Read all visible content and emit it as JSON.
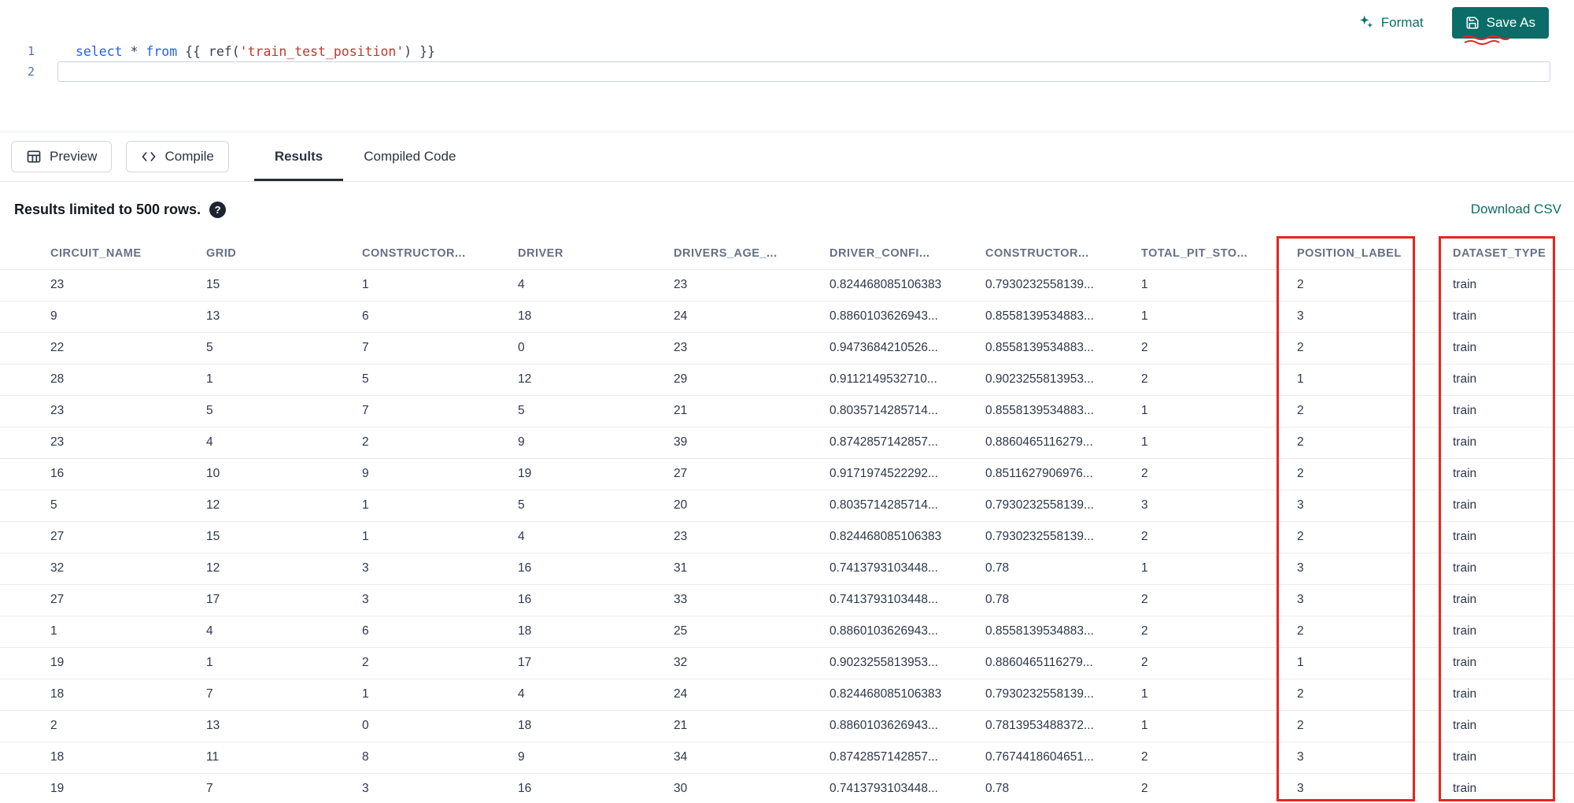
{
  "toolbar": {
    "format_label": "Format",
    "save_as_label": "Save As"
  },
  "editor": {
    "line_numbers": [
      "1",
      "2"
    ],
    "code": {
      "kw_select": "select",
      "star": " * ",
      "kw_from": "from",
      "jinja_open": " {{ ",
      "fn": "ref(",
      "string": "'train_test_position'",
      "jinja_close": ") }}"
    }
  },
  "actions": {
    "preview_label": "Preview",
    "compile_label": "Compile"
  },
  "tabs": {
    "results": "Results",
    "compiled_code": "Compiled Code"
  },
  "results": {
    "limit_note": "Results limited to 500 rows.",
    "help_glyph": "?",
    "download_label": "Download CSV",
    "columns": [
      "CIRCUIT_NAME",
      "GRID",
      "CONSTRUCTOR...",
      "DRIVER",
      "DRIVERS_AGE_...",
      "DRIVER_CONFI...",
      "CONSTRUCTOR...",
      "TOTAL_PIT_STO...",
      "POSITION_LABEL",
      "DATASET_TYPE"
    ],
    "rows": [
      [
        "23",
        "15",
        "1",
        "4",
        "23",
        "0.824468085106383",
        "0.7930232558139...",
        "1",
        "2",
        "train"
      ],
      [
        "9",
        "13",
        "6",
        "18",
        "24",
        "0.8860103626943...",
        "0.8558139534883...",
        "1",
        "3",
        "train"
      ],
      [
        "22",
        "5",
        "7",
        "0",
        "23",
        "0.9473684210526...",
        "0.8558139534883...",
        "2",
        "2",
        "train"
      ],
      [
        "28",
        "1",
        "5",
        "12",
        "29",
        "0.9112149532710...",
        "0.9023255813953...",
        "2",
        "1",
        "train"
      ],
      [
        "23",
        "5",
        "7",
        "5",
        "21",
        "0.8035714285714...",
        "0.8558139534883...",
        "1",
        "2",
        "train"
      ],
      [
        "23",
        "4",
        "2",
        "9",
        "39",
        "0.8742857142857...",
        "0.8860465116279...",
        "1",
        "2",
        "train"
      ],
      [
        "16",
        "10",
        "9",
        "19",
        "27",
        "0.9171974522292...",
        "0.8511627906976...",
        "2",
        "2",
        "train"
      ],
      [
        "5",
        "12",
        "1",
        "5",
        "20",
        "0.8035714285714...",
        "0.7930232558139...",
        "3",
        "3",
        "train"
      ],
      [
        "27",
        "15",
        "1",
        "4",
        "23",
        "0.824468085106383",
        "0.7930232558139...",
        "2",
        "2",
        "train"
      ],
      [
        "32",
        "12",
        "3",
        "16",
        "31",
        "0.7413793103448...",
        "0.78",
        "1",
        "3",
        "train"
      ],
      [
        "27",
        "17",
        "3",
        "16",
        "33",
        "0.7413793103448...",
        "0.78",
        "2",
        "3",
        "train"
      ],
      [
        "1",
        "4",
        "6",
        "18",
        "25",
        "0.8860103626943...",
        "0.8558139534883...",
        "2",
        "2",
        "train"
      ],
      [
        "19",
        "1",
        "2",
        "17",
        "32",
        "0.9023255813953...",
        "0.8860465116279...",
        "2",
        "1",
        "train"
      ],
      [
        "18",
        "7",
        "1",
        "4",
        "24",
        "0.824468085106383",
        "0.7930232558139...",
        "1",
        "2",
        "train"
      ],
      [
        "2",
        "13",
        "0",
        "18",
        "21",
        "0.8860103626943...",
        "0.7813953488372...",
        "1",
        "2",
        "train"
      ],
      [
        "18",
        "11",
        "8",
        "9",
        "34",
        "0.8742857142857...",
        "0.7674418604651...",
        "2",
        "3",
        "train"
      ],
      [
        "19",
        "7",
        "3",
        "16",
        "30",
        "0.7413793103448...",
        "0.78",
        "2",
        "3",
        "train"
      ]
    ]
  },
  "annotations": {
    "highlight_color": "#e5261f",
    "highlighted_columns": [
      "POSITION_LABEL",
      "DATASET_TYPE"
    ]
  },
  "colors": {
    "accent_teal": "#0c6d68",
    "keyword_blue": "#2563eb",
    "string_red": "#c0392b"
  }
}
